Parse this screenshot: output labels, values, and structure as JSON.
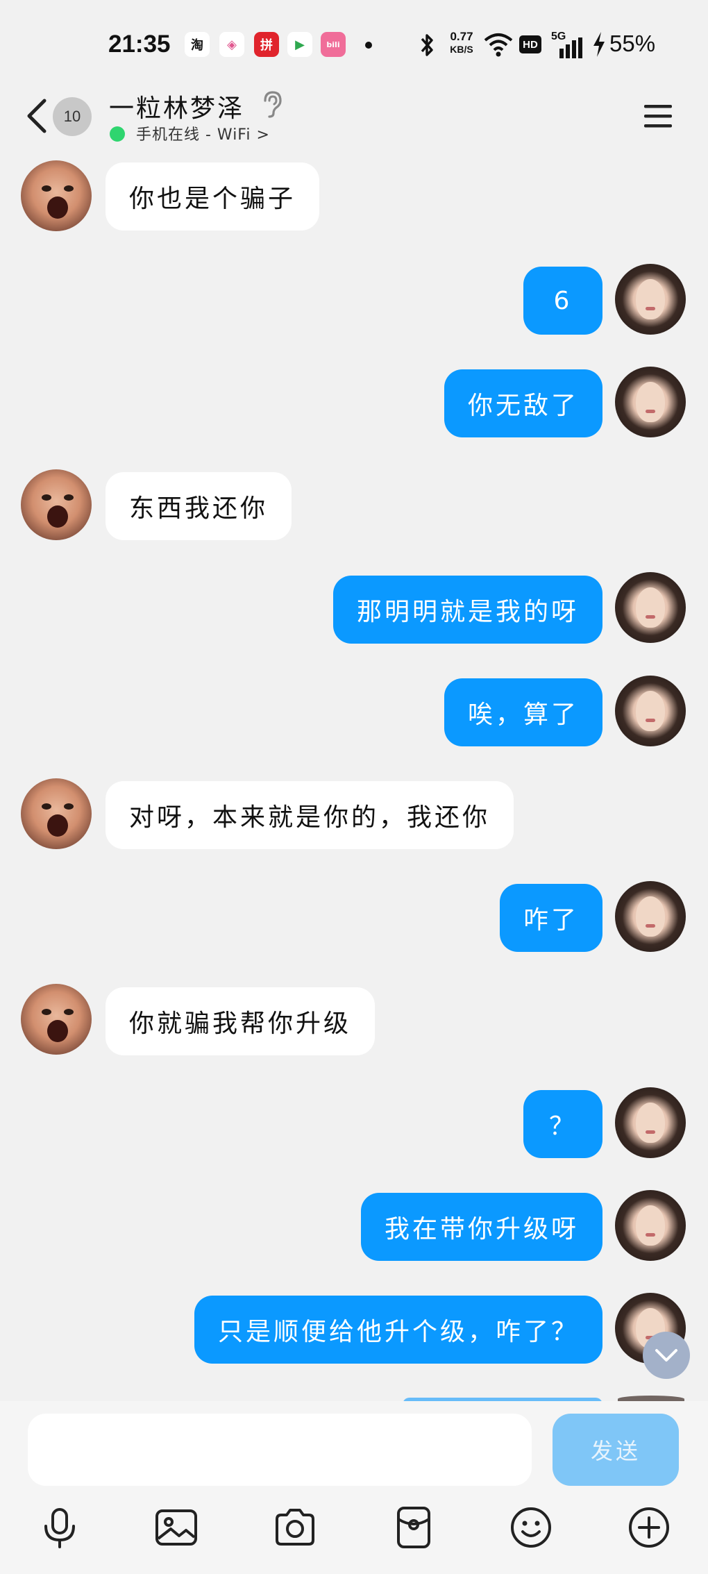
{
  "status_bar": {
    "time": "21:35",
    "app_icons": [
      {
        "name": "taobao-icon",
        "glyph": "淘",
        "color": "#ffffff",
        "text_color": "#111111"
      },
      {
        "name": "colorful-app-icon",
        "glyph": "◈",
        "color": "#ffffff",
        "text_color": "#e0568e"
      },
      {
        "name": "pinduoduo-icon",
        "glyph": "拼",
        "color": "#e0242c",
        "text_color": "#ffffff"
      },
      {
        "name": "video-app-icon",
        "glyph": "▶",
        "color": "#ffffff",
        "text_color": "#2fa84f"
      },
      {
        "name": "bilibili-icon",
        "glyph": "bili",
        "color": "#f06d99",
        "text_color": "#ffffff"
      }
    ],
    "net_speed_value": "0.77",
    "net_speed_unit": "KB/S",
    "hd_label": "HD",
    "network_label": "5G",
    "battery": "55%"
  },
  "header": {
    "unread_count": "10",
    "contact_name": "一粒林梦泽",
    "online_status": "手机在线 - WiFi >"
  },
  "messages": [
    {
      "side": "other",
      "text": "你也是个骗子"
    },
    {
      "side": "me",
      "text": "6"
    },
    {
      "side": "me",
      "text": "你无敌了"
    },
    {
      "side": "other",
      "text": "东西我还你"
    },
    {
      "side": "me",
      "text": "那明明就是我的呀"
    },
    {
      "side": "me",
      "text": "唉，算了"
    },
    {
      "side": "other",
      "text": "对呀，本来就是你的，我还你"
    },
    {
      "side": "me",
      "text": "咋了"
    },
    {
      "side": "other",
      "text": "你就骗我帮你升级"
    },
    {
      "side": "me",
      "text": "？"
    },
    {
      "side": "me",
      "text": "我在带你升级呀"
    },
    {
      "side": "me",
      "text": "只是顺便给他升个级，咋了？"
    }
  ],
  "input": {
    "value": "",
    "send_label": "发送"
  },
  "colors": {
    "accent": "#0b99ff",
    "background": "#f1f1f1",
    "online": "#2fd56f"
  }
}
